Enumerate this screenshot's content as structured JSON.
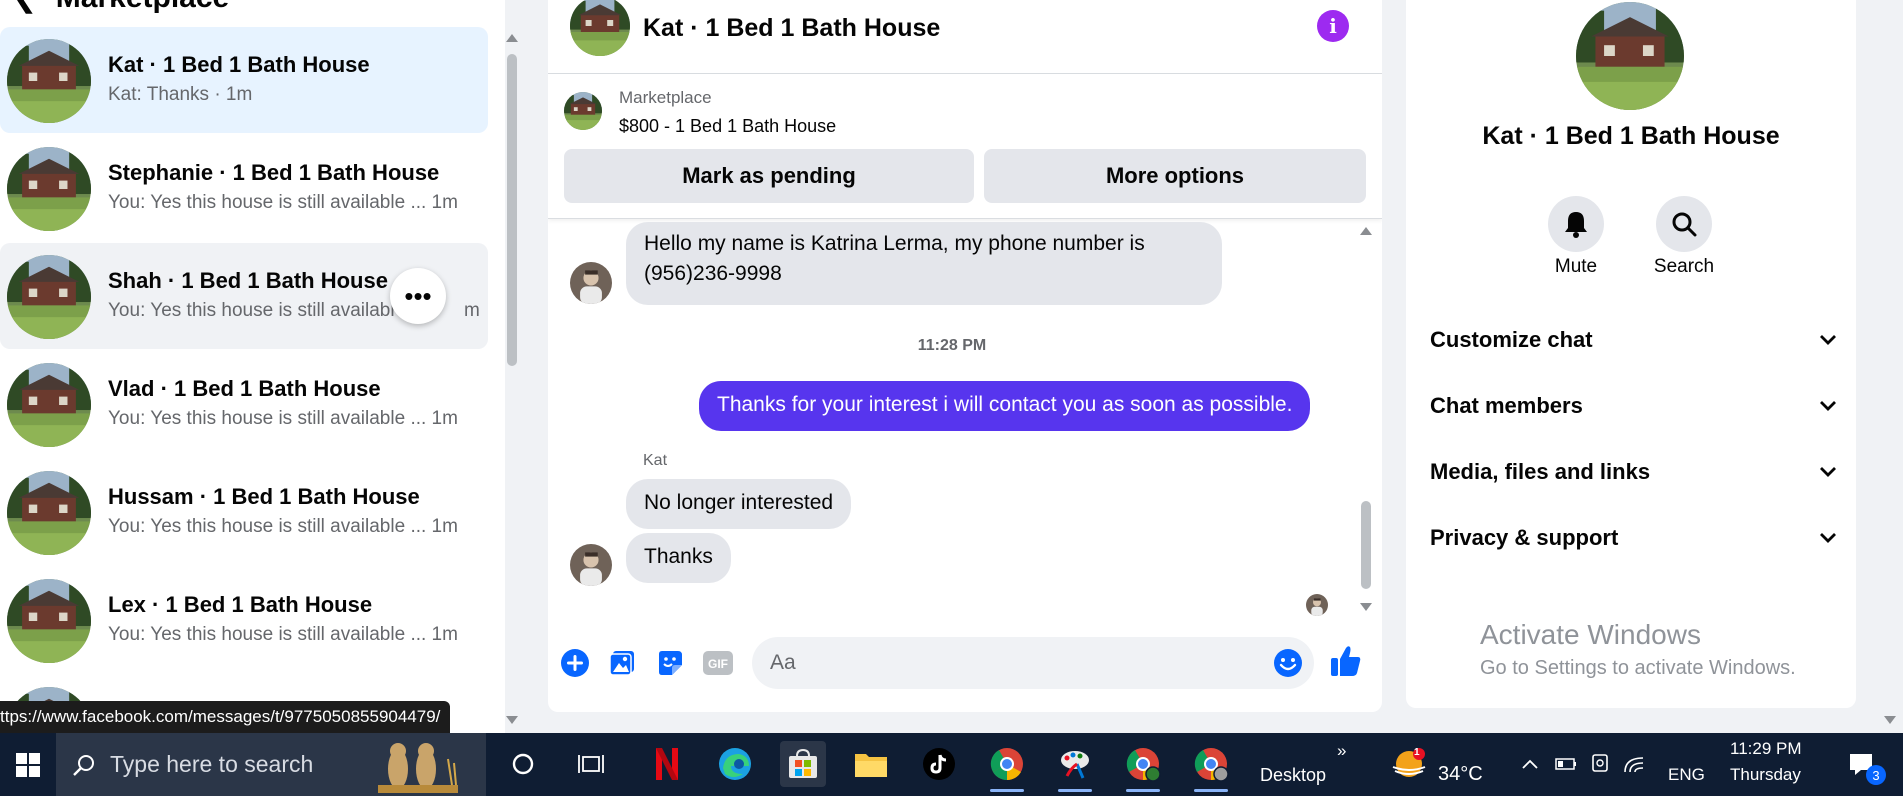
{
  "sidebar": {
    "title": "Marketplace",
    "conversations": [
      {
        "name": "Kat · 1 Bed 1 Bath House",
        "preview": "Kat: Thanks · 1m"
      },
      {
        "name": "Stephanie · 1 Bed 1 Bath House",
        "preview": "You: Yes this house is still available ... 1m"
      },
      {
        "name": "Shah · 1 Bed 1 Bath House",
        "preview": "You: Yes this house is still availabl"
      },
      {
        "name": "Vlad · 1 Bed 1 Bath House",
        "preview": "You: Yes this house is still available ... 1m"
      },
      {
        "name": "Hussam · 1 Bed 1 Bath House",
        "preview": "You: Yes this house is still available ... 1m"
      },
      {
        "name": "Lex · 1 Bed 1 Bath House",
        "preview": "You: Yes this house is still available ... 1m"
      }
    ],
    "hover_preview_tail": "m"
  },
  "status_url": "ttps://www.facebook.com/messages/t/9775050855904479/",
  "chat": {
    "title": "Kat · 1 Bed 1 Bath House",
    "info_icon": "i",
    "marketplace": {
      "label": "Marketplace",
      "listing": "$800 - 1 Bed 1 Bath House",
      "mark_pending": "Mark as pending",
      "more_options": "More options"
    },
    "messages": {
      "first_line1": "Hello my name is Katrina Lerma, my phone number is",
      "first_line2": "(956)236-9998",
      "time": "11:28 PM",
      "outgoing": "Thanks for your interest i will contact you as soon as possible.",
      "sender": "Kat",
      "reply1": "No longer interested",
      "reply2": "Thanks"
    },
    "composer_placeholder": "Aa",
    "accent_color": "#5735ee"
  },
  "info_panel": {
    "name": "Kat · 1 Bed 1 Bath House",
    "mute_label": "Mute",
    "search_label": "Search",
    "sections": [
      "Customize chat",
      "Chat members",
      "Media, files and links",
      "Privacy & support"
    ]
  },
  "watermark": {
    "line1": "Activate Windows",
    "line2": "Go to Settings to activate Windows."
  },
  "taskbar": {
    "search_placeholder": "Type here to search",
    "desktop_label": "Desktop",
    "weather_temp": "34°C",
    "weather_badge": "1",
    "language": "ENG",
    "time": "11:29 PM",
    "day": "Thursday",
    "notification_count": "3",
    "overflow": "»"
  }
}
